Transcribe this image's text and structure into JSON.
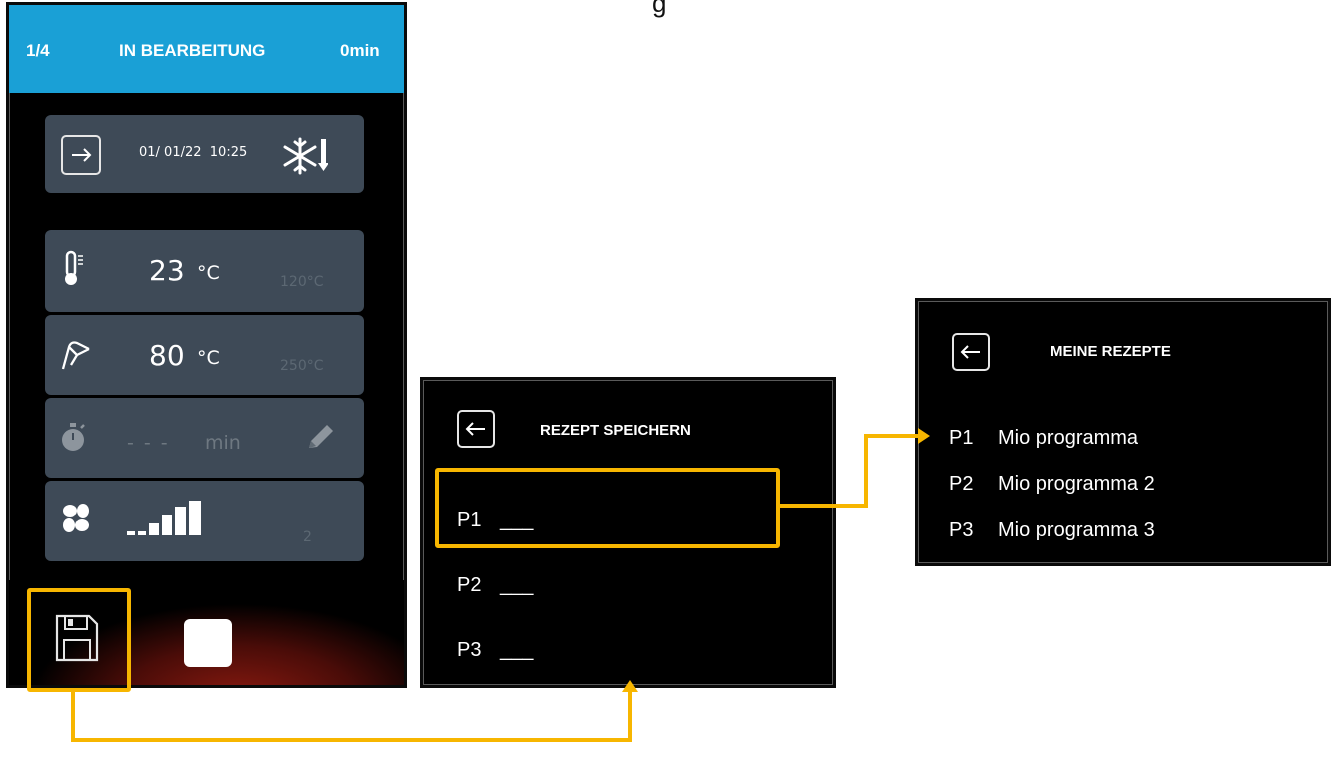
{
  "partial_top_text": "g",
  "device": {
    "header": {
      "step": "1/4",
      "status": "IN BEARBEITUNG",
      "time": "0min"
    },
    "schedule_card": {
      "datetime": "01/ 01/22  10:25"
    },
    "temperature_card": {
      "value": "23",
      "unit": "°C",
      "max": "120°C"
    },
    "probe_card": {
      "value": "80",
      "unit": "°C",
      "max": "250°C"
    },
    "timer_card": {
      "value": "- - -",
      "unit": "min"
    },
    "fan_card": {
      "level": "2"
    }
  },
  "save_screen": {
    "title": "REZEPT SPEICHERN",
    "slots": [
      {
        "id": "P1",
        "name": "___"
      },
      {
        "id": "P2",
        "name": "___"
      },
      {
        "id": "P3",
        "name": "___"
      }
    ]
  },
  "recipes_screen": {
    "title": "MEINE REZEPTE",
    "recipes": [
      {
        "id": "P1",
        "name": "Mio programma"
      },
      {
        "id": "P2",
        "name": "Mio programma 2"
      },
      {
        "id": "P3",
        "name": "Mio programma 3"
      }
    ]
  },
  "colors": {
    "header": "#1aa0d6",
    "card": "#3e4a57",
    "highlight": "#f7b600"
  }
}
